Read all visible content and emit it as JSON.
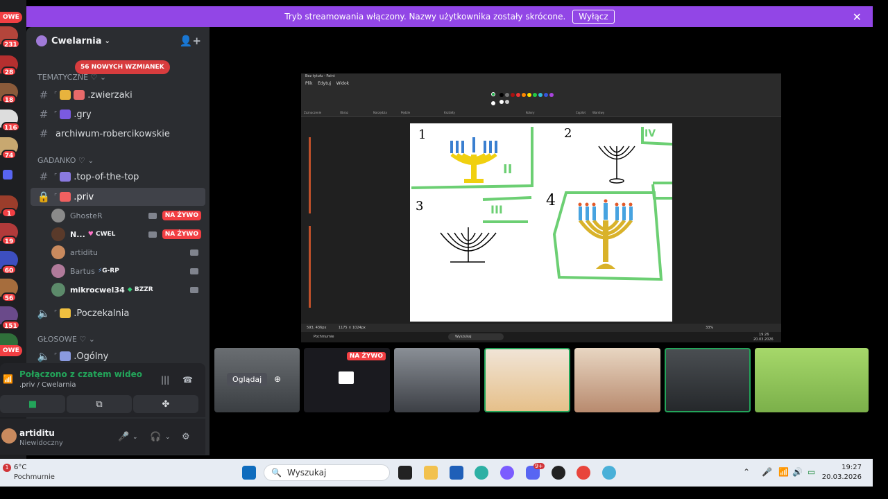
{
  "banner": {
    "text": "Tryb streamowania włączony. Nazwy użytkownika zostały skrócone.",
    "button": "Wyłącz"
  },
  "rail": {
    "tags": [
      "OWE",
      "OWE"
    ],
    "counts": [
      "231",
      "28",
      "18",
      "116",
      "74",
      "1",
      "19",
      "60",
      "56",
      "151"
    ]
  },
  "server": {
    "name": "Cwelarnia"
  },
  "mentions_pill": "56 NOWYCH WZMIANEK",
  "categories": {
    "tematyczne": "TEMATYCZNE ♡",
    "gadanko": "GADANKO ♡",
    "glosowe": "GŁOSOWE ♡"
  },
  "channels": {
    "zwierzaki": ".zwierzaki",
    "gry": ".gry",
    "archiwum": "archiwum-robercikowskie",
    "top": ".top-of-the-top",
    "priv": ".priv",
    "poczekalnia": ".Poczekalnia",
    "ogolny": ".Ogólny"
  },
  "voice_users": [
    {
      "name": "GhosteR",
      "tag": "",
      "live": "NA ŻYWO"
    },
    {
      "name": "N...",
      "tag": "CWEL",
      "live": "NA ŻYWO"
    },
    {
      "name": "artiditu",
      "tag": "",
      "live": ""
    },
    {
      "name": "Bartus",
      "tag": "G-RP",
      "live": ""
    },
    {
      "name": "mikrocwel34",
      "tag": "BZZR",
      "live": ""
    }
  ],
  "voice_panel": {
    "status": "Połączono z czatem wideo",
    "location": ".priv / Cwelarnia"
  },
  "user_panel": {
    "name": "artiditu",
    "status": "Niewidoczny"
  },
  "paint": {
    "title": "Bez tytułu - Paint",
    "menu": [
      "Plik",
      "Edytuj",
      "Widok"
    ],
    "ribbon_labels": [
      "Zaznaczenie",
      "Obraz",
      "Narzędzia",
      "Pędzle",
      "Kształty",
      "Kolory",
      "Copilot",
      "Warstwy"
    ],
    "status_left": "593, 436px",
    "status_mid": "1175 × 1024px",
    "zoom": "33%",
    "canvas_numbers": [
      "1",
      "2",
      "3",
      "4"
    ],
    "roman": [
      "II",
      "IV",
      "III"
    ],
    "win_search": "Wyszukaj",
    "win_time": "19:26",
    "win_date": "20.03.2026",
    "pc_status": "Pochmurnie"
  },
  "tiles": {
    "watch": "Oglądaj",
    "live": "NA ŻYWO"
  },
  "taskbar": {
    "temp": "6°C",
    "weather": "Pochmurnie",
    "weather_badge": "1",
    "search": "Wyszukaj",
    "time": "19:27",
    "date": "20.03.2026",
    "discord_badge": "9+"
  },
  "colors": {
    "banner": "#9246e6",
    "sidebar": "#2b2d31",
    "live": "#f23f43",
    "connected": "#23a55a",
    "accent_green": "#6ccf73"
  }
}
